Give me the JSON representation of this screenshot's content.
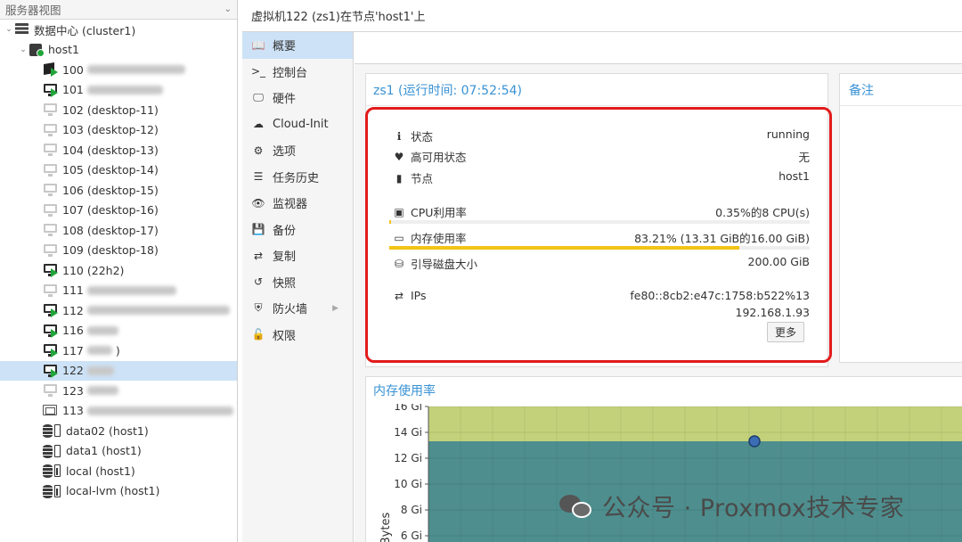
{
  "tree": {
    "header": "服务器视图",
    "datacenter": "数据中心 (cluster1)",
    "host": "host1",
    "items": [
      {
        "id": "100",
        "label": "",
        "icon": "container-icon",
        "state": "running",
        "blur": 110
      },
      {
        "id": "101",
        "label": "",
        "icon": "vm-running-icon",
        "state": "running",
        "blur": 85
      },
      {
        "id": "102",
        "label": "(desktop-11)",
        "icon": "vm-stopped-icon",
        "state": "stopped",
        "blur": 0
      },
      {
        "id": "103",
        "label": "(desktop-12)",
        "icon": "vm-stopped-icon",
        "state": "stopped",
        "blur": 0
      },
      {
        "id": "104",
        "label": "(desktop-13)",
        "icon": "vm-stopped-icon",
        "state": "stopped",
        "blur": 0
      },
      {
        "id": "105",
        "label": "(desktop-14)",
        "icon": "vm-stopped-icon",
        "state": "stopped",
        "blur": 0
      },
      {
        "id": "106",
        "label": "(desktop-15)",
        "icon": "vm-stopped-icon",
        "state": "stopped",
        "blur": 0
      },
      {
        "id": "107",
        "label": "(desktop-16)",
        "icon": "vm-stopped-icon",
        "state": "stopped",
        "blur": 0
      },
      {
        "id": "108",
        "label": "(desktop-17)",
        "icon": "vm-stopped-icon",
        "state": "stopped",
        "blur": 0
      },
      {
        "id": "109",
        "label": "(desktop-18)",
        "icon": "vm-stopped-icon",
        "state": "stopped",
        "blur": 0
      },
      {
        "id": "110",
        "label": "(22h2)",
        "icon": "vm-running-icon",
        "state": "running",
        "blur": 0
      },
      {
        "id": "111",
        "label": "",
        "icon": "vm-stopped-icon",
        "state": "stopped",
        "blur": 100
      },
      {
        "id": "112",
        "label": "",
        "icon": "vm-running-icon",
        "state": "running",
        "blur": 160
      },
      {
        "id": "116",
        "label": "",
        "icon": "vm-running-icon",
        "state": "running",
        "blur": 35
      },
      {
        "id": "117",
        "label": ")",
        "icon": "vm-running-icon",
        "state": "running",
        "blur": 28
      },
      {
        "id": "122",
        "label": "",
        "icon": "vm-running-icon",
        "state": "running",
        "blur": 30,
        "selected": true
      },
      {
        "id": "123",
        "label": "",
        "icon": "vm-stopped-icon",
        "state": "stopped",
        "blur": 35
      },
      {
        "id": "113",
        "label": "",
        "icon": "template-icon",
        "state": "template",
        "blur": 170
      }
    ],
    "storages": [
      {
        "label": "data02 (host1)",
        "full": false
      },
      {
        "label": "data1 (host1)",
        "full": false
      },
      {
        "label": "local (host1)",
        "full": true
      },
      {
        "label": "local-lvm (host1)",
        "full": true
      }
    ]
  },
  "title_bar": "虚拟机122 (zs1)在节点'host1'上",
  "nav": [
    {
      "label": "概要",
      "icon": "book-icon",
      "glyph": "📖",
      "active": true
    },
    {
      "label": "控制台",
      "icon": "terminal-icon",
      "glyph": ">_"
    },
    {
      "label": "硬件",
      "icon": "monitor-icon",
      "glyph": "🖵"
    },
    {
      "label": "Cloud-Init",
      "icon": "cloud-icon",
      "glyph": "☁"
    },
    {
      "label": "选项",
      "icon": "gear-icon",
      "glyph": "⚙"
    },
    {
      "label": "任务历史",
      "icon": "list-icon",
      "glyph": "☰"
    },
    {
      "label": "监视器",
      "icon": "eye-icon",
      "glyph": "👁"
    },
    {
      "label": "备份",
      "icon": "floppy-icon",
      "glyph": "💾"
    },
    {
      "label": "复制",
      "icon": "retweet-icon",
      "glyph": "⇄"
    },
    {
      "label": "快照",
      "icon": "history-icon",
      "glyph": "↺"
    },
    {
      "label": "防火墙",
      "icon": "shield-icon",
      "glyph": "⛨",
      "arrow": "▶"
    },
    {
      "label": "权限",
      "icon": "unlock-icon",
      "glyph": "🔓"
    }
  ],
  "summary": {
    "title": "zs1 (运行时间: 07:52:54)",
    "status_label": "状态",
    "status_value": "running",
    "ha_label": "高可用状态",
    "ha_value": "无",
    "node_label": "节点",
    "node_value": "host1",
    "cpu_label": "CPU利用率",
    "cpu_value": "0.35%的8 CPU(s)",
    "cpu_fraction": 0.0035,
    "mem_label": "内存使用率",
    "mem_value": "83.21% (13.31 GiB的16.00 GiB)",
    "mem_fraction": 0.8321,
    "disk_label": "引导磁盘大小",
    "disk_value": "200.00 GiB",
    "ips_label": "IPs",
    "ip1": "fe80::8cb2:e47c:1758:b522%13",
    "ip2": "192.168.1.93",
    "more_button": "更多"
  },
  "notes_title": "备注",
  "memory_chart": {
    "title": "内存使用率"
  },
  "chart_data": {
    "type": "area",
    "ylabel": "Bytes",
    "y_ticks": [
      "16 Gi",
      "14 Gi",
      "12 Gi",
      "10 Gi",
      "8 Gi",
      "6 Gi"
    ],
    "ylim": [
      6,
      16
    ],
    "series": [
      {
        "values": [
          16,
          16,
          16,
          16
        ],
        "color": "#c3d17a"
      },
      {
        "values": [
          13.31,
          13.31,
          13.31,
          13.31
        ],
        "color": "#4e8e8e"
      }
    ],
    "marker_value": 13.31
  },
  "watermark": "公众号 · Proxmox技术专家"
}
